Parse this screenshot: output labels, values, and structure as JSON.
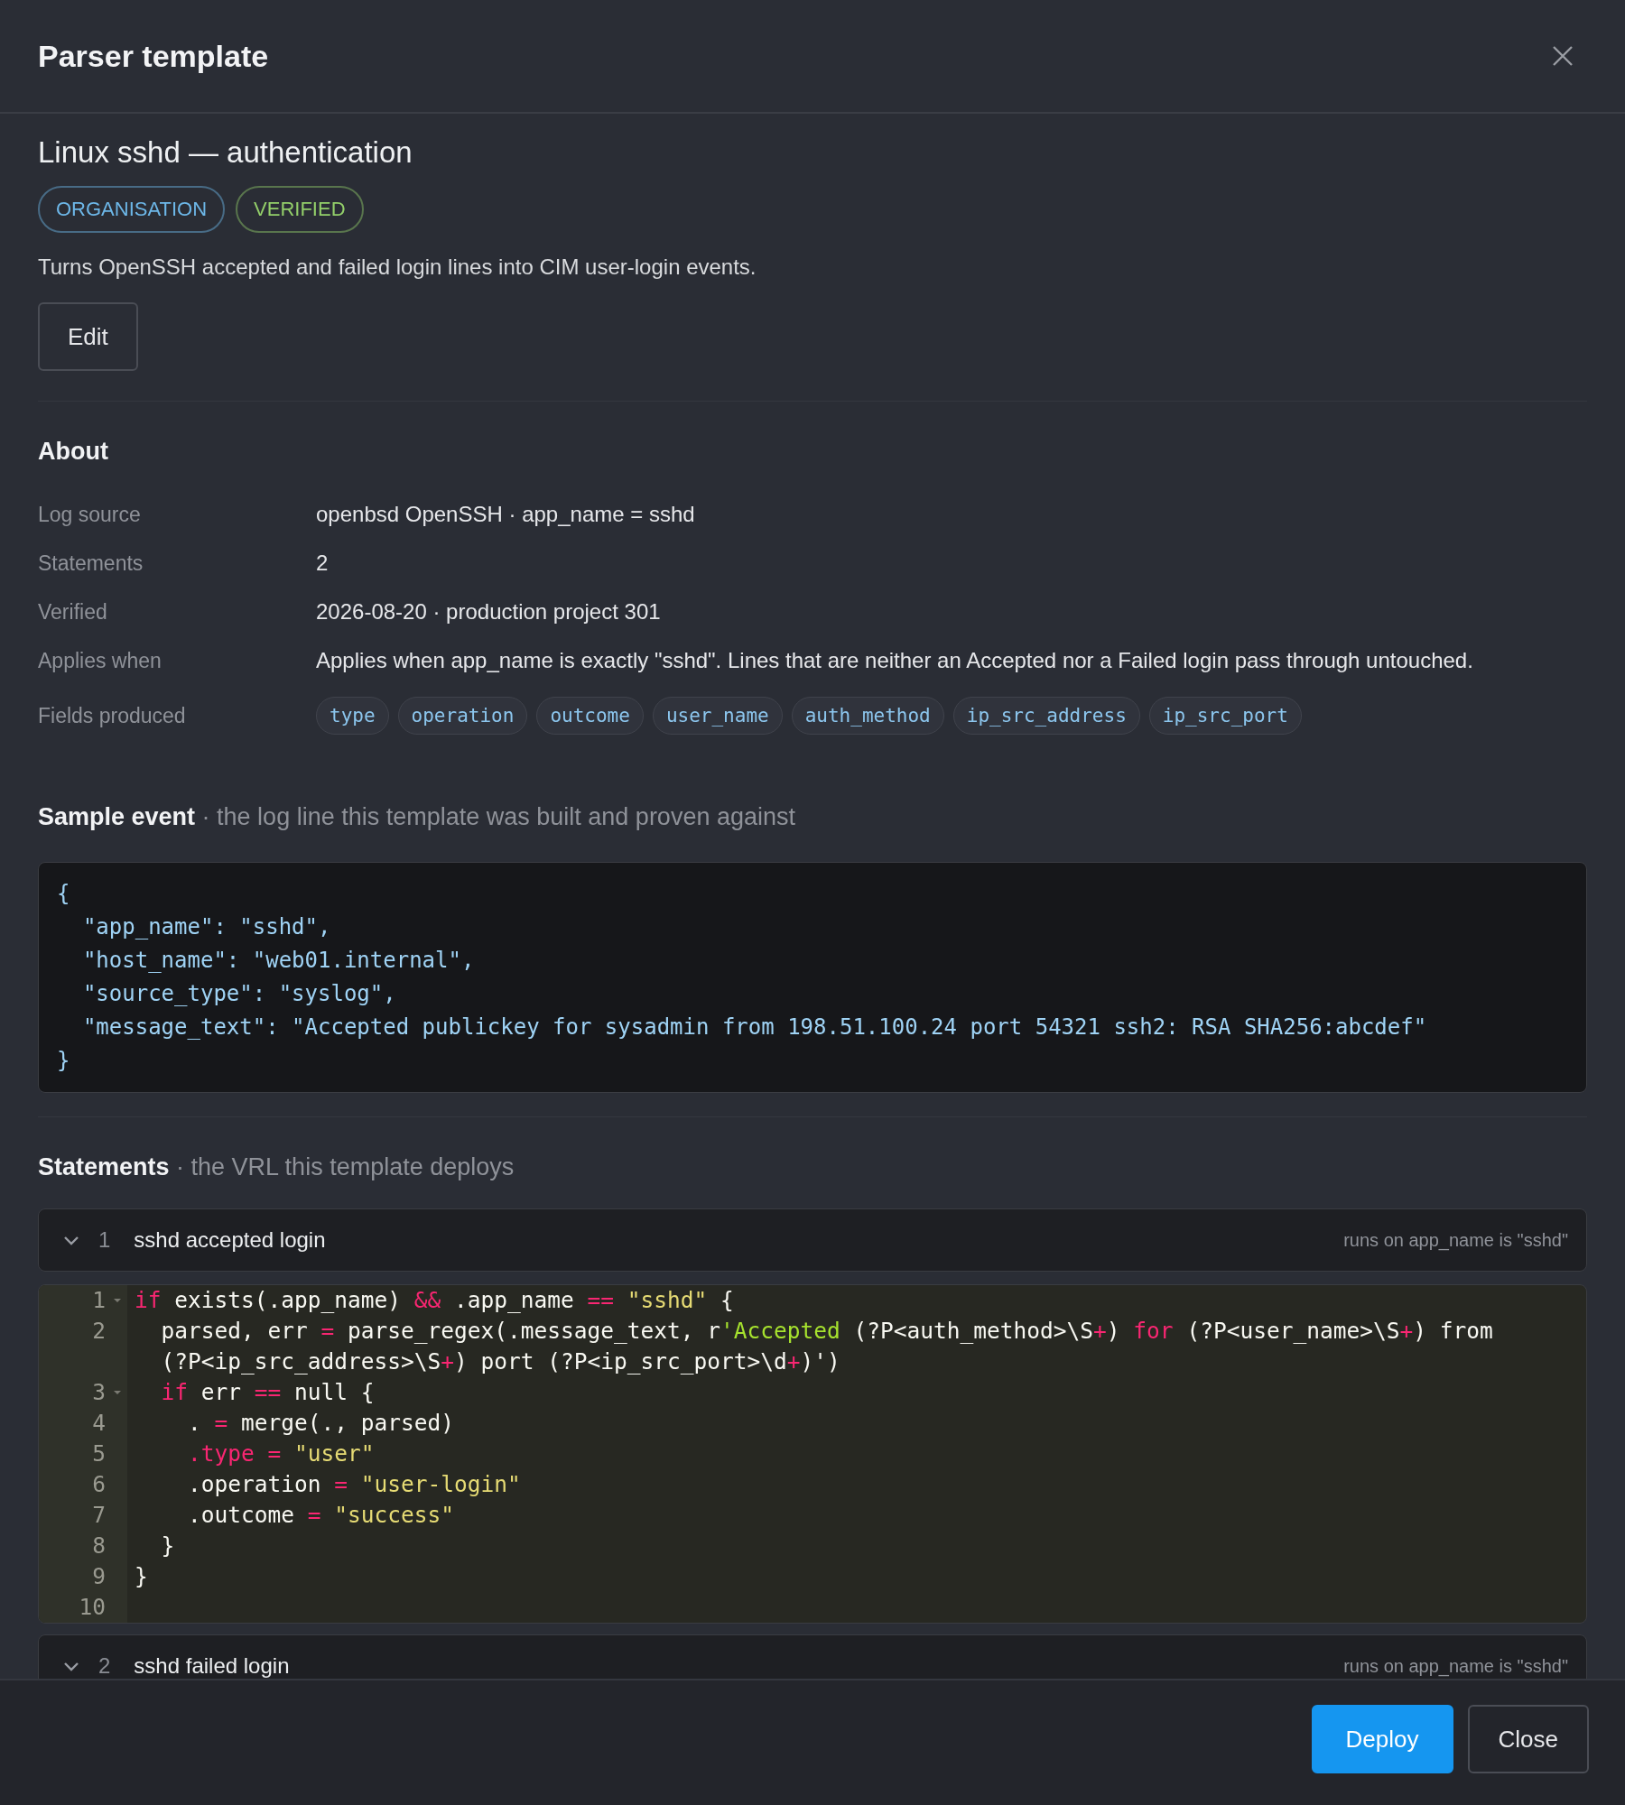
{
  "dialog": {
    "title": "Parser template"
  },
  "template": {
    "name": "Linux sshd — authentication",
    "badges": [
      {
        "label": "ORGANISATION",
        "color": "#6db7e8"
      },
      {
        "label": "VERIFIED",
        "color": "#93cf6a"
      }
    ],
    "description": "Turns OpenSSH accepted and failed login lines into CIM user-login events.",
    "edit_button": "Edit"
  },
  "about": {
    "heading": "About",
    "rows": [
      {
        "label": "Log source",
        "value": "openbsd OpenSSH · app_name = sshd"
      },
      {
        "label": "Statements",
        "value": "2"
      },
      {
        "label": "Verified",
        "value": "2026-08-20 · production project 301"
      },
      {
        "label": "Applies when",
        "value": "Applies when app_name is exactly \"sshd\". Lines that are neither an Accepted nor a Failed login pass through untouched."
      },
      {
        "label": "Fields produced",
        "fields": [
          "type",
          "operation",
          "outcome",
          "user_name",
          "auth_method",
          "ip_src_address",
          "ip_src_port"
        ]
      }
    ]
  },
  "sample_event": {
    "heading": "Sample event",
    "subheading": "· the log line this template was built and proven against",
    "lines": [
      "{",
      "  \"app_name\": \"sshd\",",
      "  \"host_name\": \"web01.internal\",",
      "  \"source_type\": \"syslog\",",
      "  \"message_text\": \"Accepted publickey for sysadmin from 198.51.100.24 port 54321 ssh2: RSA SHA256:abcdef\"",
      "}"
    ]
  },
  "statements": {
    "heading": "Statements",
    "subheading": "· the VRL this template deploys",
    "items": [
      {
        "number": "1",
        "title": "sshd accepted login",
        "condition": "runs on app_name is \"sshd\"",
        "expanded": true,
        "code": [
          {
            "number": "1",
            "foldable": true,
            "tokens": [
              {
                "kind": "keyword",
                "text": "if"
              },
              {
                "kind": "plain",
                "text": " exists(.app_name) "
              },
              {
                "kind": "operator",
                "text": "&&"
              },
              {
                "kind": "plain",
                "text": " .app_name "
              },
              {
                "kind": "operator",
                "text": "== "
              },
              {
                "kind": "string",
                "text": "\"sshd\""
              },
              {
                "kind": "plain",
                "text": " {"
              }
            ]
          },
          {
            "number": "2",
            "foldable": false,
            "tokens": [
              {
                "kind": "plain",
                "text": "  parsed, err "
              },
              {
                "kind": "operator",
                "text": "="
              },
              {
                "kind": "plain",
                "text": " parse_regex(.message_text, r"
              },
              {
                "kind": "regex",
                "text": "'Accepted"
              },
              {
                "kind": "plain",
                "text": " (?P<auth_method>\\S"
              },
              {
                "kind": "operator",
                "text": "+"
              },
              {
                "kind": "plain",
                "text": ") "
              },
              {
                "kind": "keyword",
                "text": "for"
              },
              {
                "kind": "plain",
                "text": " (?P<user_name>\\S"
              },
              {
                "kind": "operator",
                "text": "+"
              },
              {
                "kind": "plain",
                "text": ") from "
              },
              {
                "kind": "plain",
                "text": "(?P<ip_src_address>\\S"
              },
              {
                "kind": "operator",
                "text": "+"
              },
              {
                "kind": "plain",
                "text": ") port (?P<ip_src_port>\\d"
              },
              {
                "kind": "operator",
                "text": "+"
              },
              {
                "kind": "plain",
                "text": ")')"
              }
            ]
          },
          {
            "number": "3",
            "foldable": true,
            "tokens": [
              {
                "kind": "keyword",
                "text": "  if"
              },
              {
                "kind": "plain",
                "text": " err "
              },
              {
                "kind": "operator",
                "text": "=="
              },
              {
                "kind": "plain",
                "text": " null {"
              }
            ]
          },
          {
            "number": "4",
            "foldable": false,
            "tokens": [
              {
                "kind": "plain",
                "text": "    . "
              },
              {
                "kind": "operator",
                "text": "="
              },
              {
                "kind": "plain",
                "text": " merge(., parsed)"
              }
            ]
          },
          {
            "number": "5",
            "foldable": false,
            "tokens": [
              {
                "kind": "keyword",
                "text": "    .type"
              },
              {
                "kind": "operator",
                "text": " = "
              },
              {
                "kind": "string",
                "text": "\"user\""
              }
            ]
          },
          {
            "number": "6",
            "foldable": false,
            "tokens": [
              {
                "kind": "plain",
                "text": "    .operation "
              },
              {
                "kind": "operator",
                "text": "= "
              },
              {
                "kind": "string",
                "text": "\"user-login\""
              }
            ]
          },
          {
            "number": "7",
            "foldable": false,
            "tokens": [
              {
                "kind": "plain",
                "text": "    .outcome "
              },
              {
                "kind": "operator",
                "text": "= "
              },
              {
                "kind": "string",
                "text": "\"success\""
              }
            ]
          },
          {
            "number": "8",
            "foldable": false,
            "tokens": [
              {
                "kind": "plain",
                "text": "  }"
              }
            ]
          },
          {
            "number": "9",
            "foldable": false,
            "tokens": [
              {
                "kind": "plain",
                "text": "}"
              }
            ]
          },
          {
            "number": "10",
            "foldable": false
          }
        ]
      },
      {
        "number": "2",
        "title": "sshd failed login",
        "condition": "runs on app_name is \"sshd\"",
        "expanded": true
      }
    ]
  },
  "footer": {
    "buttons": [
      {
        "label": "Deploy",
        "kind": "primary"
      },
      {
        "label": "Close",
        "kind": "secondary"
      }
    ]
  }
}
